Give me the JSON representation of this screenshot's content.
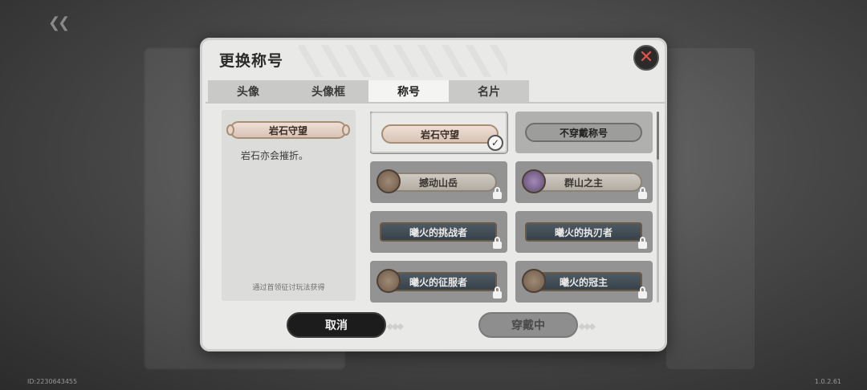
{
  "background": {
    "version": "1.0.2.61",
    "user_id": "ID:2230643455"
  },
  "dialog": {
    "title": "更换称号",
    "tabs": [
      {
        "label": "头像"
      },
      {
        "label": "头像框"
      },
      {
        "label": "称号",
        "active": true
      },
      {
        "label": "名片"
      }
    ],
    "detail": {
      "badge": "岩石守望",
      "description": "岩石亦会摧折。",
      "source": "通过首领征讨玩法获得"
    },
    "titles": [
      {
        "label": "岩石守望",
        "style": "rock",
        "selected": true,
        "locked": false
      },
      {
        "label": "不穿戴称号",
        "style": "pill",
        "selected": false,
        "locked": false
      },
      {
        "label": "撼动山岳",
        "style": "mountain",
        "selected": false,
        "locked": true
      },
      {
        "label": "群山之主",
        "style": "mountain",
        "selected": false,
        "locked": true
      },
      {
        "label": "曦火的挑战者",
        "style": "fire",
        "selected": false,
        "locked": true
      },
      {
        "label": "曦火的执刃者",
        "style": "fire",
        "selected": false,
        "locked": true
      },
      {
        "label": "曦火的征服者",
        "style": "fire",
        "selected": false,
        "locked": true
      },
      {
        "label": "曦火的冠主",
        "style": "fire",
        "selected": false,
        "locked": true
      }
    ],
    "buttons": {
      "cancel": "取消",
      "wear": "穿戴中"
    }
  },
  "colors": {
    "close_accent": "#e8524a",
    "panel_bg": "#e9e9e7"
  }
}
